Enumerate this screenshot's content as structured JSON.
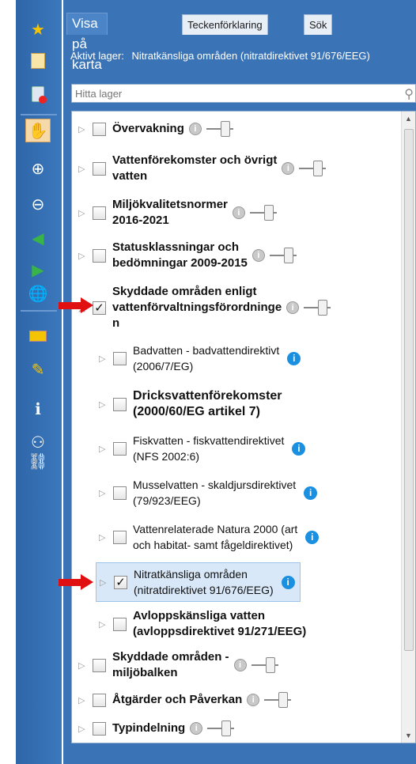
{
  "tabs": [
    {
      "label": "Visa på karta",
      "active": true
    },
    {
      "label": "Teckenförklaring",
      "active": false
    },
    {
      "label": "Sök",
      "active": false
    }
  ],
  "active_layer": {
    "label": "Aktivt lager:",
    "value": "Nitratkänsliga områden (nitratdirektivet 91/676/EEG)"
  },
  "search": {
    "placeholder": "Hitta lager"
  },
  "toolbar_icons": [
    "star-icon",
    "bookmark-icon",
    "clear-icon",
    "pan-hand-icon",
    "zoom-in-icon",
    "zoom-out-icon",
    "back-icon",
    "forward-icon",
    "globe-icon",
    "card-icon",
    "draw-icon",
    "info-icon",
    "user-icon",
    "link-icon"
  ],
  "layers": {
    "overvakning": "Övervakning",
    "vattenforekomster_1": "Vattenförekomster och övrigt",
    "vattenforekomster_2": "vatten",
    "miljokvalitet_1": "Miljökvalitetsnormer",
    "miljokvalitet_2": "2016-2021",
    "status_1": "Statusklassningar och",
    "status_2": "bedömningar 2009-2015",
    "skyddade_1": "Skyddade områden enligt",
    "skyddade_2": "vattenförvaltningsförordninge",
    "skyddade_3": "n",
    "badvatten_1": "Badvatten - badvattendirektivt",
    "badvatten_2": "(2006/7/EG)",
    "dricks_1": "Dricksvattenförekomster",
    "dricks_2": "(2000/60/EG artikel 7)",
    "fisk_1": "Fiskvatten - fiskvattendirektivet",
    "fisk_2": "(NFS 2002:6)",
    "mussel_1": "Musselvatten - skaldjursdirektivet",
    "mussel_2": "(79/923/EEG)",
    "natura_1": "Vattenrelaterade Natura 2000 (art",
    "natura_2": "och habitat- samt fågeldirektivet)",
    "nitrat_1": "Nitratkänsliga områden",
    "nitrat_2": "(nitratdirektivet 91/676/EEG)",
    "avlopp_1": "Avloppskänsliga vatten",
    "avlopp_2": "(avloppsdirektivet 91/271/EEG)",
    "miljobalken_1": "Skyddade områden -",
    "miljobalken_2": "miljöbalken",
    "atgarder": "Åtgärder och Påverkan",
    "typindelning": "Typindelning"
  },
  "checked": {
    "skyddade": true,
    "nitrat": true
  },
  "colors": {
    "panel": "#3a74b7",
    "toolbar": "#2e66a8",
    "highlight": "#e01010",
    "info_blue": "#1b8fe0"
  }
}
